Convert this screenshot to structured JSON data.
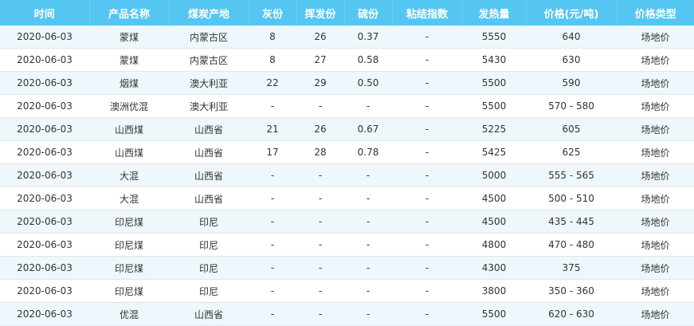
{
  "headers": [
    "时间",
    "产品名称",
    "煤炭产地",
    "灰份",
    "挥发份",
    "硫份",
    "粘结指数",
    "发热量",
    "价格(元/吨)",
    "价格类型"
  ],
  "rows": [
    [
      "2020-06-03",
      "蒙煤",
      "内蒙古区",
      "8",
      "26",
      "0.37",
      "-",
      "5550",
      "640",
      "场地价"
    ],
    [
      "2020-06-03",
      "蒙煤",
      "内蒙古区",
      "8",
      "27",
      "0.58",
      "-",
      "5430",
      "630",
      "场地价"
    ],
    [
      "2020-06-03",
      "烟煤",
      "澳大利亚",
      "22",
      "29",
      "0.50",
      "-",
      "5500",
      "590",
      "场地价"
    ],
    [
      "2020-06-03",
      "澳洲优混",
      "澳大利亚",
      "-",
      "-",
      "-",
      "-",
      "5500",
      "570 - 580",
      "场地价"
    ],
    [
      "2020-06-03",
      "山西煤",
      "山西省",
      "21",
      "26",
      "0.67",
      "-",
      "5225",
      "605",
      "场地价"
    ],
    [
      "2020-06-03",
      "山西煤",
      "山西省",
      "17",
      "28",
      "0.78",
      "-",
      "5425",
      "625",
      "场地价"
    ],
    [
      "2020-06-03",
      "大混",
      "山西省",
      "-",
      "-",
      "-",
      "-",
      "5000",
      "555 - 565",
      "场地价"
    ],
    [
      "2020-06-03",
      "大混",
      "山西省",
      "-",
      "-",
      "-",
      "-",
      "4500",
      "500 - 510",
      "场地价"
    ],
    [
      "2020-06-03",
      "印尼煤",
      "印尼",
      "-",
      "-",
      "-",
      "-",
      "4500",
      "435 - 445",
      "场地价"
    ],
    [
      "2020-06-03",
      "印尼煤",
      "印尼",
      "-",
      "-",
      "-",
      "-",
      "4800",
      "470 - 480",
      "场地价"
    ],
    [
      "2020-06-03",
      "印尼煤",
      "印尼",
      "-",
      "-",
      "-",
      "-",
      "4300",
      "375",
      "场地价"
    ],
    [
      "2020-06-03",
      "印尼煤",
      "印尼",
      "-",
      "-",
      "-",
      "-",
      "3800",
      "350 - 360",
      "场地价"
    ],
    [
      "2020-06-03",
      "优混",
      "山西省",
      "-",
      "-",
      "-",
      "-",
      "5500",
      "620 - 630",
      "场地价"
    ]
  ],
  "colors": {
    "header_bg": "#55c6f2",
    "stripe_bg": "#eef7fc"
  }
}
